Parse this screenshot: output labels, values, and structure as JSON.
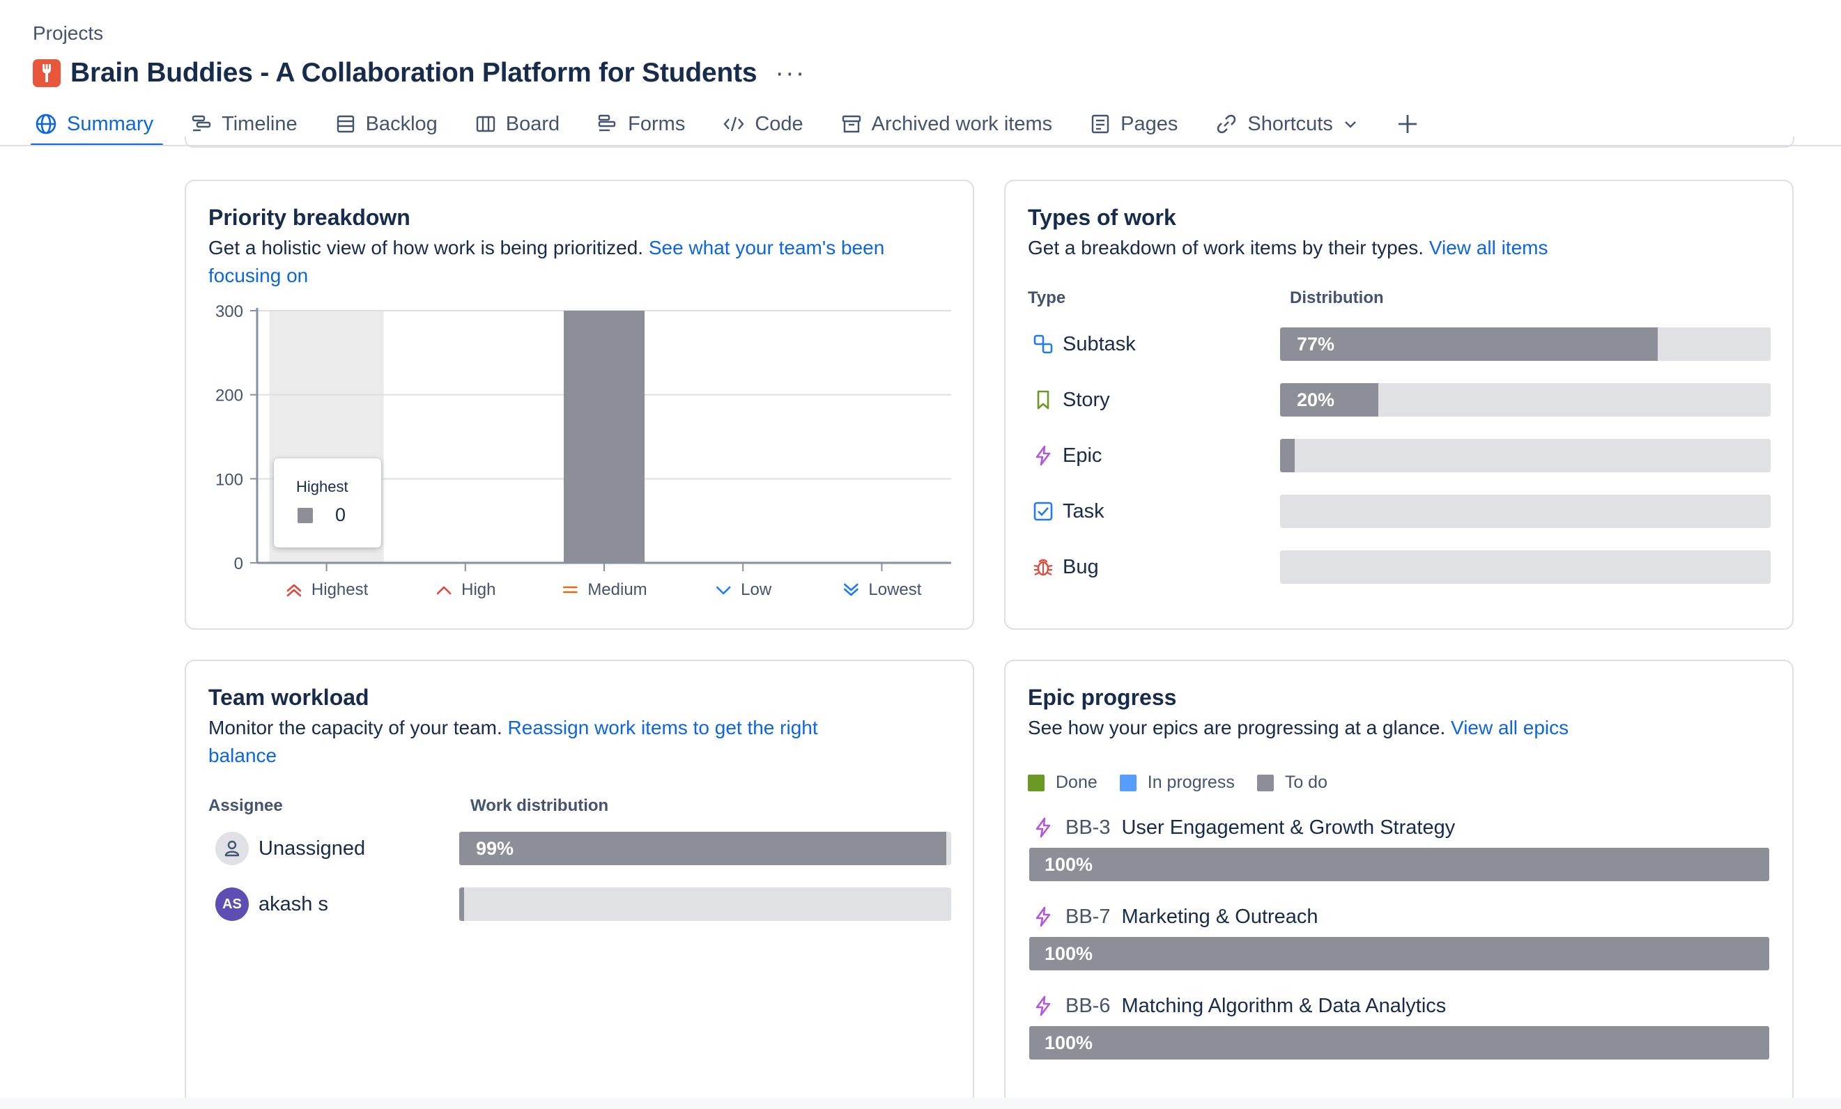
{
  "breadcrumb": "Projects",
  "project": {
    "title": "Brain Buddies - A Collaboration Platform for Students",
    "more": "···"
  },
  "tabs": [
    {
      "label": "Summary",
      "icon": "globe-icon",
      "active": true
    },
    {
      "label": "Timeline",
      "icon": "timeline-icon"
    },
    {
      "label": "Backlog",
      "icon": "backlog-icon"
    },
    {
      "label": "Board",
      "icon": "board-icon"
    },
    {
      "label": "Forms",
      "icon": "forms-icon"
    },
    {
      "label": "Code",
      "icon": "code-icon"
    },
    {
      "label": "Archived work items",
      "icon": "archive-icon"
    },
    {
      "label": "Pages",
      "icon": "pages-icon"
    },
    {
      "label": "Shortcuts",
      "icon": "link-icon"
    }
  ],
  "priority": {
    "title": "Priority breakdown",
    "desc": "Get a holistic view of how work is being prioritized. ",
    "link_line1": "See what your team's been",
    "link_line2": "focusing on",
    "tooltip": {
      "label": "Highest",
      "value": "0"
    }
  },
  "chart_data": {
    "type": "bar",
    "categories": [
      "Highest",
      "High",
      "Medium",
      "Low",
      "Lowest"
    ],
    "values": [
      0,
      0,
      300,
      0,
      0
    ],
    "ylim": [
      0,
      300
    ],
    "yticks": [
      "0",
      "100",
      "200",
      "300"
    ],
    "highlighted_category": "Highest",
    "grid": true,
    "category_colors": [
      "#e2483d",
      "#e2483d",
      "#e56910",
      "#1d7afc",
      "#1d7afc"
    ],
    "bar_color": "#8c8f97"
  },
  "types": {
    "title": "Types of work",
    "desc": "Get a breakdown of work items by their types. ",
    "link": "View all items",
    "col_type": "Type",
    "col_dist": "Distribution",
    "rows": [
      {
        "label": "Subtask",
        "icon": "subtask-icon",
        "pct": 77,
        "text": "77%"
      },
      {
        "label": "Story",
        "icon": "story-icon",
        "pct": 20,
        "text": "20%"
      },
      {
        "label": "Epic",
        "icon": "epic-icon",
        "pct": 3,
        "text": ""
      },
      {
        "label": "Task",
        "icon": "task-icon",
        "pct": 0,
        "text": ""
      },
      {
        "label": "Bug",
        "icon": "bug-icon",
        "pct": 0,
        "text": ""
      }
    ]
  },
  "workload": {
    "title": "Team workload",
    "desc": "Monitor the capacity of your team. ",
    "link_line1": "Reassign work items to get the right",
    "link_line2": "balance",
    "col_assignee": "Assignee",
    "col_dist": "Work distribution",
    "rows": [
      {
        "name": "Unassigned",
        "avatar": "person-icon",
        "pct": 99,
        "text": "99%"
      },
      {
        "name": "akash s",
        "avatar": "AS",
        "pct": 1,
        "text": ""
      }
    ]
  },
  "epics": {
    "title": "Epic progress",
    "desc": "See how your epics are progressing at a glance. ",
    "link": "View all epics",
    "legend": [
      {
        "label": "Done",
        "color": "#6a9a23"
      },
      {
        "label": "In progress",
        "color": "#579dff"
      },
      {
        "label": "To do",
        "color": "#8c8f97"
      }
    ],
    "rows": [
      {
        "key": "BB-3",
        "title": "User Engagement & Growth Strategy",
        "pct_todo": 100,
        "text": "100%"
      },
      {
        "key": "BB-7",
        "title": "Marketing & Outreach",
        "pct_todo": 100,
        "text": "100%"
      },
      {
        "key": "BB-6",
        "title": "Matching Algorithm & Data Analytics",
        "pct_todo": 100,
        "text": "100%"
      }
    ]
  },
  "colors": {
    "accent": "#0c66e4",
    "bar": "#8c8f97",
    "track": "#dfe1e5"
  }
}
